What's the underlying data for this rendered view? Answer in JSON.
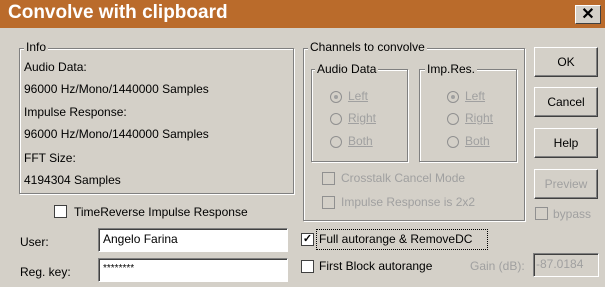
{
  "window": {
    "title": "Convolve with clipboard",
    "close_glyph": "✕"
  },
  "info": {
    "legend": "Info",
    "audio_label": "Audio Data:",
    "audio_value": "96000 Hz/Mono/1440000 Samples",
    "impulse_label": "Impulse Response:",
    "impulse_value": "96000 Hz/Mono/1440000 Samples",
    "fft_label": "FFT Size:",
    "fft_value": "4194304 Samples"
  },
  "channels": {
    "legend": "Channels to convolve",
    "audio_legend": "Audio Data",
    "imp_legend": "Imp.Res.",
    "audio_options": [
      {
        "label": "Left",
        "selected": true
      },
      {
        "label": "Right",
        "selected": false
      },
      {
        "label": "Both",
        "selected": false
      }
    ],
    "imp_options": [
      {
        "label": "Left",
        "selected": true
      },
      {
        "label": "Right",
        "selected": false
      },
      {
        "label": "Both",
        "selected": false
      }
    ],
    "crosstalk_label": "Crosstalk Cancel Mode",
    "impulse2x2_label": "Impulse Response is 2x2"
  },
  "buttons": {
    "ok": "OK",
    "cancel": "Cancel",
    "help": "Help",
    "preview": "Preview",
    "bypass": "bypass"
  },
  "options": {
    "timereverse_label": "TimeReverse Impulse Response",
    "full_autorange_label": "Full autorange & RemoveDC",
    "full_autorange_checked": true,
    "first_block_label": "First Block autorange",
    "first_block_checked": false
  },
  "user": {
    "label": "User:",
    "value": "Angelo Farina"
  },
  "regkey": {
    "label": "Reg. key:",
    "value": "********"
  },
  "gain": {
    "label": "Gain (dB):",
    "value": "-87.0184"
  }
}
